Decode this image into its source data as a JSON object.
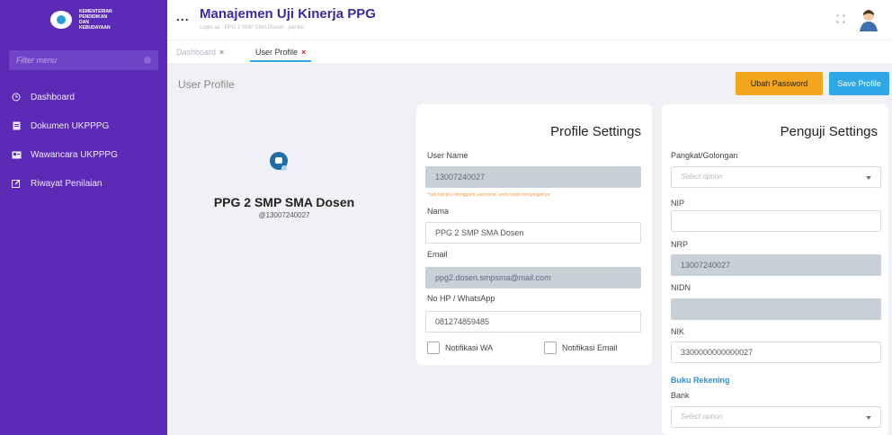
{
  "sidebar": {
    "logo_text": "KEMENTERIAN PENDIDIKAN DAN KEBUDAYAAN",
    "filter_placeholder": "Filter menu",
    "items": [
      {
        "label": "Dashboard",
        "icon": "clock-icon"
      },
      {
        "label": "Dokumen UKPPPG",
        "icon": "document-icon"
      },
      {
        "label": "Wawancara UKPPPG",
        "icon": "id-card-icon"
      },
      {
        "label": "Riwayat Penilaian",
        "icon": "edit-icon"
      }
    ]
  },
  "header": {
    "menu_dots": "...",
    "title": "Manajemen Uji Kinerja PPG",
    "login_as": "Login as : PPG 2 SMP SMA Dosen - penilai"
  },
  "tabs": [
    {
      "label": "Dashboard",
      "close": "×"
    },
    {
      "label": "User Profile",
      "close": "×"
    }
  ],
  "page": {
    "title": "User Profile",
    "ubah_password": "Ubah Password",
    "save_profile": "Save Profile"
  },
  "profile": {
    "name": "PPG 2 SMP SMA Dosen",
    "handle": "@13007240027"
  },
  "profile_settings": {
    "title": "Profile Settings",
    "username_label": "User Name",
    "username_value": "13007240027",
    "username_hint": "*hati-hati jika mengganti username, anda wajib mengingatnya",
    "nama_label": "Nama",
    "nama_value": "PPG 2 SMP SMA Dosen",
    "email_label": "Email",
    "email_value": "ppg2.dosen.smpsma@mail.com",
    "hp_label": "No HP / WhatsApp",
    "hp_value": "081274859485",
    "notif_wa": "Notifikasi WA",
    "notif_email": "Notifikasi Email"
  },
  "penguji_settings": {
    "title": "Penguji Settings",
    "pangkat_label": "Pangkat/Golongan",
    "select_placeholder": "Select option",
    "nip_label": "NIP",
    "nip_value": "",
    "nrp_label": "NRP",
    "nrp_value": "13007240027",
    "nidn_label": "NIDN",
    "nidn_value": "",
    "nik_label": "NIK",
    "nik_value": "3300000000000027",
    "buku_rekening": "Buku Rekening",
    "bank_label": "Bank"
  },
  "colors": {
    "sidebar": "#5b2bb8",
    "title": "#3b2aa5",
    "warning_button": "#f3a51b",
    "primary_button": "#2fa6e6"
  }
}
